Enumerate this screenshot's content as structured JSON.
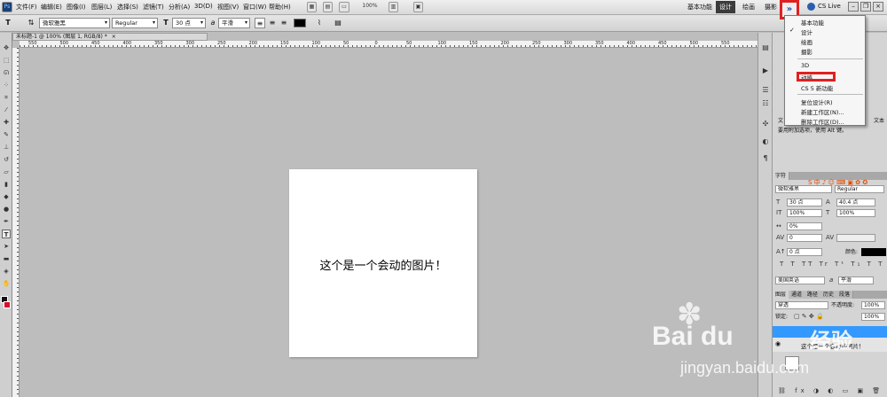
{
  "menu": {
    "app_icon": "Ps",
    "items": [
      "文件(F)",
      "编辑(E)",
      "图像(I)",
      "图层(L)",
      "选择(S)",
      "滤镜(T)",
      "分析(A)",
      "3D(D)",
      "视图(V)",
      "窗口(W)",
      "帮助(H)"
    ],
    "zoom": "100%"
  },
  "workspace": {
    "basic": "基本功能",
    "design": "设计",
    "paint": "绘画",
    "photo": "摄影",
    "expand": "»",
    "cs_live": "CS Live"
  },
  "dropdown": {
    "items": [
      "基本功能",
      "设计",
      "绘画",
      "摄影",
      "3D",
      "动感",
      "CS 5 新功能",
      "复位设计(R)",
      "新建工作区(N)...",
      "删除工作区(D)..."
    ],
    "checked": "设计",
    "highlighted": "动感"
  },
  "options": {
    "tool_icon": "T",
    "font_family": "微软雅黑",
    "font_style": "Regular",
    "font_size": "30 点",
    "antialias_icon": "a",
    "antialias": "平滑"
  },
  "document": {
    "tab_title": "未标题-1 @ 100% (图层 1, RGB/8) *",
    "ruler_ticks": [
      "550",
      "500",
      "450",
      "400",
      "350",
      "300",
      "250",
      "200",
      "150",
      "100",
      "50",
      "0",
      "50",
      "100",
      "150",
      "200",
      "250",
      "300",
      "350",
      "400",
      "450",
      "500",
      "550"
    ]
  },
  "canvas": {
    "text": "这个是一个会动的图片！"
  },
  "character_panel": {
    "tab_label": "字符",
    "font_family": "微软雅黑",
    "font_style": "Regular",
    "size": "30 点",
    "leading": "40.4 点",
    "vertical_scale": "100%",
    "horizontal_scale": "100%",
    "tracking_pct": "0%",
    "kerning": "0",
    "baseline": "0 点",
    "color_label": "颜色:",
    "language": "美国英语",
    "antialias": "平滑",
    "text_color": "#000000"
  },
  "layers_panel": {
    "tabs": [
      "图层",
      "通道",
      "路径",
      "历史",
      "段落"
    ],
    "blend_mode": "穿透",
    "opacity_label": "不透明度:",
    "opacity": "100%",
    "lock_label": "锁定:",
    "fill": "100%",
    "layer_name": "这个是一个会动的图片！"
  },
  "side_note": {
    "line1": "文",
    "line2": "要用附加选项，使用 Alt 键。",
    "text_suffix": "文本"
  },
  "watermark": {
    "brand": "Bai  du",
    "sub": "经验",
    "url": "jingyan.baidu.com"
  },
  "colors": {
    "menubar": "#e4e4e4",
    "workspace_bg": "#bdbdbd",
    "highlight_red": "#e02020",
    "selection_blue": "#3399ff",
    "bg_swatch": "#d8102a"
  }
}
